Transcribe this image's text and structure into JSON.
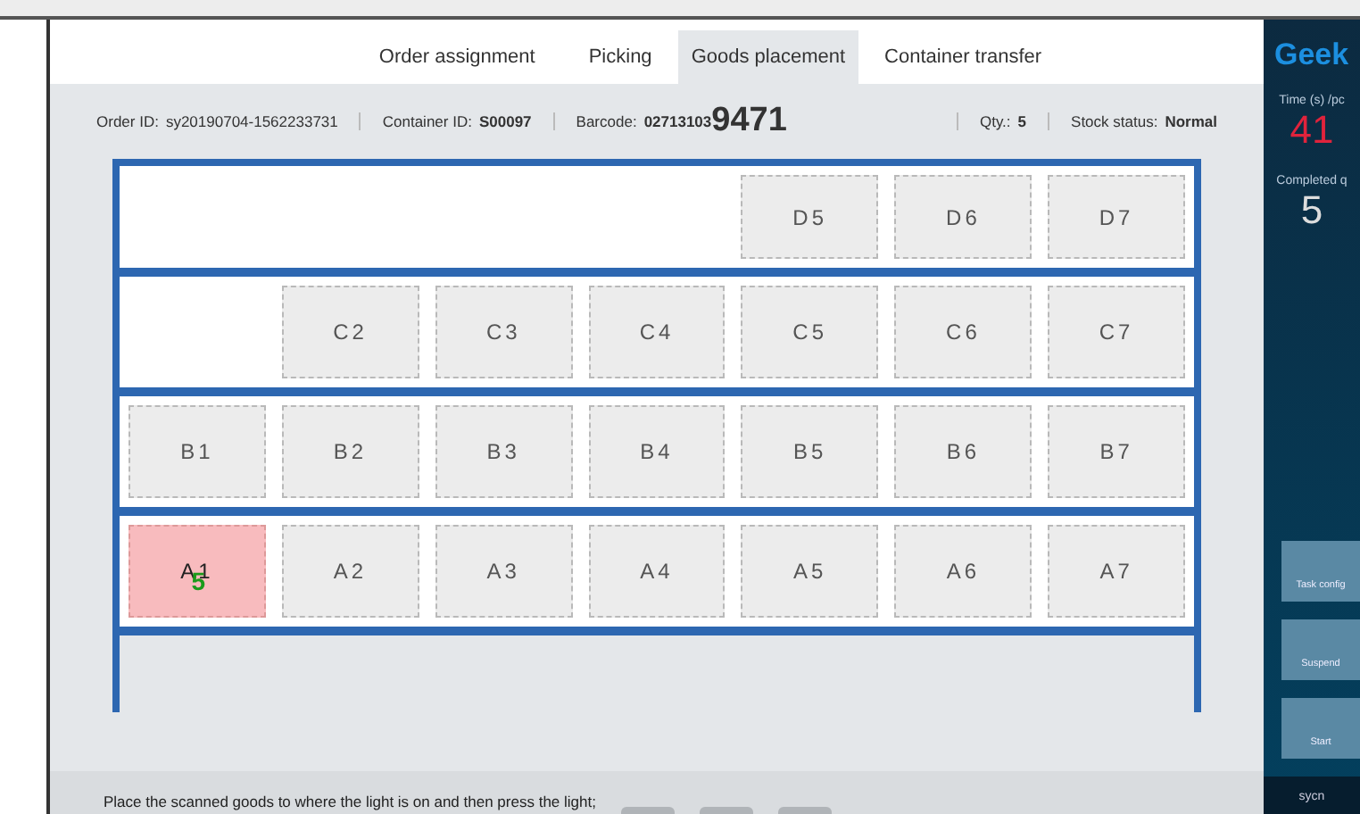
{
  "tabs": [
    {
      "label": "Order assignment",
      "selected": false
    },
    {
      "label": "Picking",
      "selected": false
    },
    {
      "label": "Goods placement",
      "selected": true
    },
    {
      "label": "Container transfer",
      "selected": false
    }
  ],
  "info": {
    "order_id": {
      "label": "Order ID:",
      "value": "sy20190704-1562233731"
    },
    "container_id": {
      "label": "Container ID:",
      "value": "S00097"
    },
    "barcode": {
      "label": "Barcode:",
      "prefix": "02713103",
      "suffix": "9471"
    },
    "qty": {
      "label": "Qty.:",
      "value": "5"
    },
    "stock_status": {
      "label": "Stock status:",
      "value": "Normal"
    }
  },
  "shelf": {
    "rows": [
      {
        "cells": [
          {
            "kind": "empty"
          },
          {
            "kind": "empty"
          },
          {
            "kind": "empty"
          },
          {
            "kind": "empty"
          },
          {
            "kind": "slot",
            "label": "D5",
            "lit": false
          },
          {
            "kind": "slot",
            "label": "D6",
            "lit": false
          },
          {
            "kind": "slot",
            "label": "D7",
            "lit": false
          }
        ]
      },
      {
        "cells": [
          {
            "kind": "empty"
          },
          {
            "kind": "slot",
            "label": "C2",
            "lit": false
          },
          {
            "kind": "slot",
            "label": "C3",
            "lit": false
          },
          {
            "kind": "slot",
            "label": "C4",
            "lit": false
          },
          {
            "kind": "slot",
            "label": "C5",
            "lit": false
          },
          {
            "kind": "slot",
            "label": "C6",
            "lit": false
          },
          {
            "kind": "slot",
            "label": "C7",
            "lit": false
          }
        ]
      },
      {
        "cells": [
          {
            "kind": "slot",
            "label": "B1",
            "lit": false
          },
          {
            "kind": "slot",
            "label": "B2",
            "lit": false
          },
          {
            "kind": "slot",
            "label": "B3",
            "lit": false
          },
          {
            "kind": "slot",
            "label": "B4",
            "lit": false
          },
          {
            "kind": "slot",
            "label": "B5",
            "lit": false
          },
          {
            "kind": "slot",
            "label": "B6",
            "lit": false
          },
          {
            "kind": "slot",
            "label": "B7",
            "lit": false
          }
        ]
      },
      {
        "cells": [
          {
            "kind": "slot",
            "label": "A1",
            "lit": true,
            "count": "5"
          },
          {
            "kind": "slot",
            "label": "A2",
            "lit": false
          },
          {
            "kind": "slot",
            "label": "A3",
            "lit": false
          },
          {
            "kind": "slot",
            "label": "A4",
            "lit": false
          },
          {
            "kind": "slot",
            "label": "A5",
            "lit": false
          },
          {
            "kind": "slot",
            "label": "A6",
            "lit": false
          },
          {
            "kind": "slot",
            "label": "A7",
            "lit": false
          }
        ]
      }
    ]
  },
  "status_bar": {
    "message": "Place the scanned goods to where the light is on and then press the light;"
  },
  "side_panel": {
    "brand": "Geek",
    "time_label": "Time (s) /pc",
    "time_value": "41",
    "completed_label": "Completed q",
    "completed_value": "5",
    "buttons": [
      "Task config",
      "Suspend",
      "Start"
    ],
    "user": "sycn"
  }
}
